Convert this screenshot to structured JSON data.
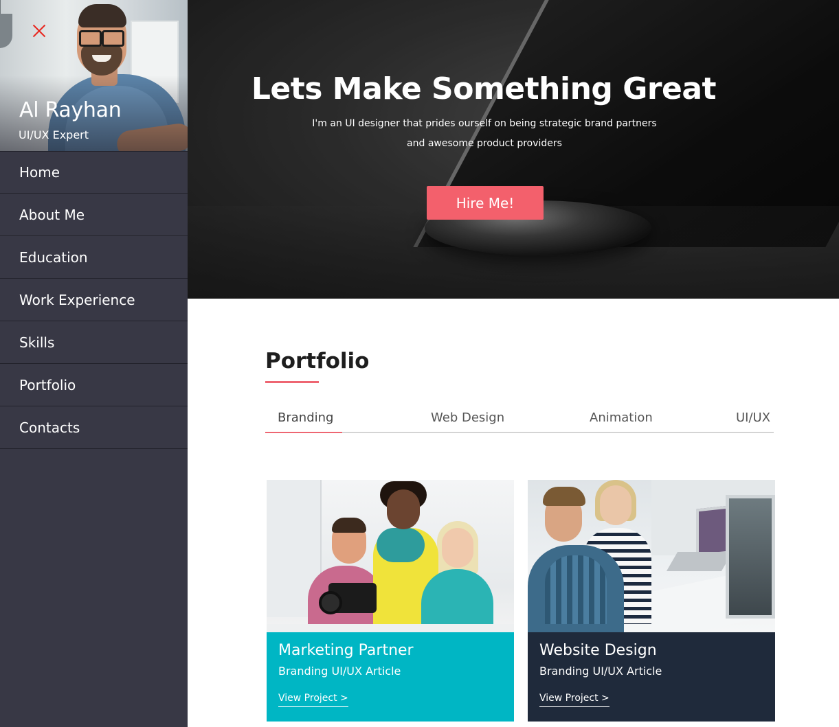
{
  "sidebar": {
    "profile": {
      "name": "Al Rayhan",
      "role": "UI/UX Expert"
    },
    "close_icon": "close-icon",
    "items": [
      {
        "label": "Home"
      },
      {
        "label": "About Me"
      },
      {
        "label": "Education"
      },
      {
        "label": "Work Experience"
      },
      {
        "label": "Skills"
      },
      {
        "label": "Portfolio"
      },
      {
        "label": "Contacts"
      }
    ]
  },
  "hero": {
    "title": "Lets Make Something Great",
    "subtitle": "I'm an UI designer that prides ourself on being strategic brand partners and awesome product providers",
    "button_label": "Hire Me!"
  },
  "portfolio": {
    "title": "Portfolio",
    "tabs": [
      {
        "label": "Branding",
        "active": true
      },
      {
        "label": "Web Design",
        "active": false
      },
      {
        "label": "Animation",
        "active": false
      },
      {
        "label": "UI/UX",
        "active": false
      }
    ],
    "cards": [
      {
        "title": "Marketing Partner",
        "subtitle": "Branding UI/UX Article",
        "link": "View Project >"
      },
      {
        "title": "Website Design",
        "subtitle": "Branding UI/UX Article",
        "link": "View Project >"
      }
    ]
  },
  "colors": {
    "sidebar_bg": "#383845",
    "accent": "#f3606c",
    "card_teal": "#00b6c4",
    "card_navy": "#1f2a3b",
    "close_red": "#e8251d"
  }
}
